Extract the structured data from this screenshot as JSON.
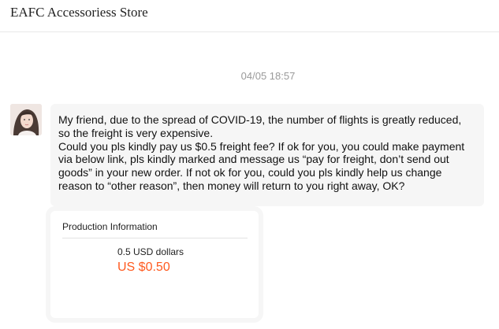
{
  "header": {
    "store_name": "EAFC Accessoriess Store"
  },
  "chat": {
    "timestamp": "04/05 18:57",
    "message": {
      "paragraph_1": "My friend, due to the spread of COVID-19, the number of flights is greatly reduced, so the freight is very expensive.",
      "paragraph_2": "Could you pls kindly pay us $0.5 freight fee? If ok for you, you could make payment via below link, pls kindly marked and message us “pay for freight, don’t send out goods” in your new order. If not ok for you, could you pls kindly help us change reason to “other reason”, then money will return to you right away, OK?"
    },
    "product_card": {
      "title": "Production Information",
      "product_name": "0.5 USD dollars",
      "price": "US $0.50",
      "price_color": "#ff5a1f"
    }
  },
  "colors": {
    "bubble_bg": "#f6f6f6",
    "timestamp": "#9a9a9a"
  }
}
